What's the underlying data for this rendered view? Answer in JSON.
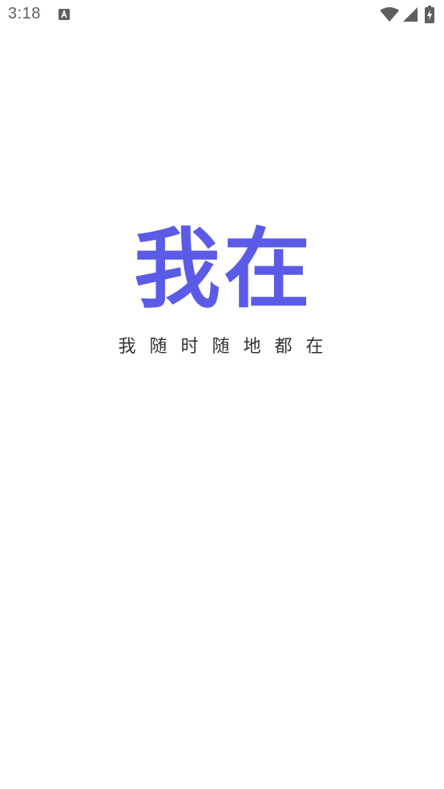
{
  "status_bar": {
    "time": "3:18",
    "notification_icon": "text-a-icon",
    "wifi_icon": "wifi-icon",
    "signal_icon": "cell-signal-icon",
    "battery_icon": "battery-charging-icon"
  },
  "splash": {
    "logo_text": "我在",
    "slogan": "我随时随地都在",
    "brand_color": "#5b5be8",
    "slogan_color": "#333333"
  },
  "colors": {
    "background": "#ffffff",
    "status_icons": "#5f5f5f"
  }
}
